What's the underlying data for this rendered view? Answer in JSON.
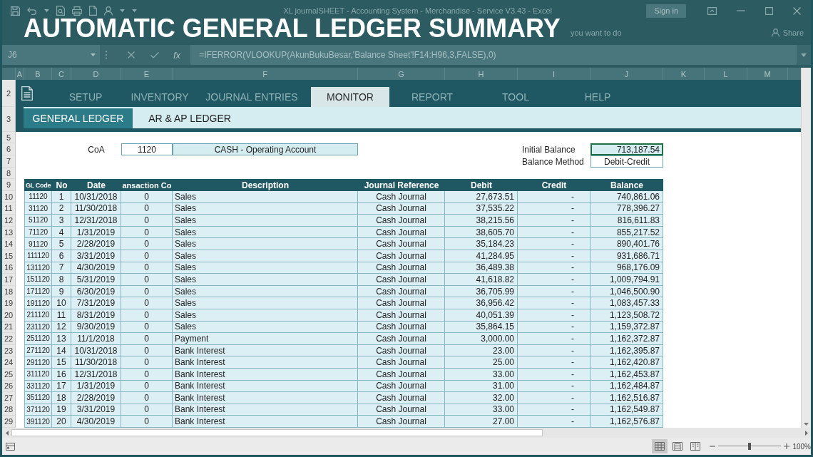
{
  "window": {
    "title": "XL journalSHEET - Accounting System - Merchandise - Service V3.43 - Excel",
    "sign_in": "Sign in"
  },
  "banner_title": "AUTOMATIC GENERAL LEDGER SUMMARY",
  "ribbon": {
    "tell_me": "you want to do",
    "share": "Share"
  },
  "formula_bar": {
    "name_box": "J6",
    "function_label": "fx",
    "formula": "=IFERROR(VLOOKUP(AkunBukuBesar,'Balance Sheet'!F14:H96,3,FALSE),0)"
  },
  "column_headers": [
    "A",
    "B",
    "C",
    "D",
    "E",
    "F",
    "G",
    "H",
    "I",
    "J",
    "K",
    "L",
    "M"
  ],
  "menu": {
    "row_number": "2",
    "tabs": [
      {
        "label": "SETUP",
        "selected": false
      },
      {
        "label": "INVENTORY",
        "selected": false
      },
      {
        "label": "JOURNAL ENTRIES",
        "selected": false
      },
      {
        "label": "MONITOR",
        "selected": true
      },
      {
        "label": "REPORT",
        "selected": false
      },
      {
        "label": "TOOL",
        "selected": false
      },
      {
        "label": "HELP",
        "selected": false
      }
    ]
  },
  "sub_menu": {
    "row_number": "3",
    "tabs": [
      {
        "label": "GENERAL LEDGER",
        "selected": true
      },
      {
        "label": "AR & AP LEDGER",
        "selected": false
      }
    ]
  },
  "form_rows": [
    {
      "kind": "blank",
      "row_number": "5"
    },
    {
      "kind": "account",
      "row_number": "6",
      "coa_label": "CoA",
      "coa_code": "1120",
      "coa_name": "CASH - Operating Account",
      "balance_label": "Initial Balance",
      "balance_value": "713,187.54",
      "balance_active": true
    },
    {
      "kind": "method",
      "row_number": "7",
      "label": "Balance Method",
      "value": "Debit-Credit"
    },
    {
      "kind": "blank",
      "row_number": "8"
    }
  ],
  "ledger": {
    "row_number": "9",
    "columns": [
      "GL Code",
      "No",
      "Date",
      "ansaction Co",
      "Description",
      "Journal Reference",
      "Debit",
      "Credit",
      "Balance"
    ],
    "rows": [
      {
        "row_number": "10",
        "cells": [
          "11120",
          "1",
          "10/31/2018",
          "0",
          "Sales",
          "Cash Journal",
          "27,673.51",
          "-",
          "740,861.06"
        ]
      },
      {
        "row_number": "11",
        "cells": [
          "31120",
          "2",
          "11/30/2018",
          "0",
          "Sales",
          "Cash Journal",
          "37,535.22",
          "-",
          "778,396.27"
        ]
      },
      {
        "row_number": "12",
        "cells": [
          "51120",
          "3",
          "12/31/2018",
          "0",
          "Sales",
          "Cash Journal",
          "38,215.56",
          "-",
          "816,611.83"
        ]
      },
      {
        "row_number": "13",
        "cells": [
          "71120",
          "4",
          "1/31/2019",
          "0",
          "Sales",
          "Cash Journal",
          "38,605.70",
          "-",
          "855,217.52"
        ]
      },
      {
        "row_number": "14",
        "cells": [
          "91120",
          "5",
          "2/28/2019",
          "0",
          "Sales",
          "Cash Journal",
          "35,184.23",
          "-",
          "890,401.76"
        ]
      },
      {
        "row_number": "15",
        "cells": [
          "111120",
          "6",
          "3/31/2019",
          "0",
          "Sales",
          "Cash Journal",
          "41,284.95",
          "-",
          "931,686.71"
        ]
      },
      {
        "row_number": "16",
        "cells": [
          "131120",
          "7",
          "4/30/2019",
          "0",
          "Sales",
          "Cash Journal",
          "36,489.38",
          "-",
          "968,176.09"
        ]
      },
      {
        "row_number": "17",
        "cells": [
          "151120",
          "8",
          "5/31/2019",
          "0",
          "Sales",
          "Cash Journal",
          "41,618.82",
          "-",
          "1,009,794.91"
        ]
      },
      {
        "row_number": "18",
        "cells": [
          "171120",
          "9",
          "6/30/2019",
          "0",
          "Sales",
          "Cash Journal",
          "36,705.99",
          "-",
          "1,046,500.90"
        ]
      },
      {
        "row_number": "19",
        "cells": [
          "191120",
          "10",
          "7/31/2019",
          "0",
          "Sales",
          "Cash Journal",
          "36,956.42",
          "-",
          "1,083,457.33"
        ]
      },
      {
        "row_number": "20",
        "cells": [
          "211120",
          "11",
          "8/31/2019",
          "0",
          "Sales",
          "Cash Journal",
          "40,051.39",
          "-",
          "1,123,508.72"
        ]
      },
      {
        "row_number": "21",
        "cells": [
          "231120",
          "12",
          "9/30/2019",
          "0",
          "Sales",
          "Cash Journal",
          "35,864.15",
          "-",
          "1,159,372.87"
        ]
      },
      {
        "row_number": "22",
        "cells": [
          "251120",
          "13",
          "11/1/2018",
          "0",
          "Payment",
          "Cash Journal",
          "3,000.00",
          "-",
          "1,162,372.87"
        ]
      },
      {
        "row_number": "23",
        "cells": [
          "271120",
          "14",
          "10/31/2018",
          "0",
          "Bank Interest",
          "Cash Journal",
          "23.00",
          "-",
          "1,162,395.87"
        ]
      },
      {
        "row_number": "24",
        "cells": [
          "291120",
          "15",
          "11/30/2018",
          "0",
          "Bank Interest",
          "Cash Journal",
          "25.00",
          "-",
          "1,162,420.87"
        ]
      },
      {
        "row_number": "25",
        "cells": [
          "311120",
          "16",
          "12/31/2018",
          "0",
          "Bank Interest",
          "Cash Journal",
          "33.00",
          "-",
          "1,162,453.87"
        ]
      },
      {
        "row_number": "26",
        "cells": [
          "331120",
          "17",
          "1/31/2019",
          "0",
          "Bank Interest",
          "Cash Journal",
          "31.00",
          "-",
          "1,162,484.87"
        ]
      },
      {
        "row_number": "27",
        "cells": [
          "351120",
          "18",
          "2/28/2019",
          "0",
          "Bank Interest",
          "Cash Journal",
          "32.00",
          "-",
          "1,162,516.87"
        ]
      },
      {
        "row_number": "28",
        "cells": [
          "371120",
          "19",
          "3/31/2019",
          "0",
          "Bank Interest",
          "Cash Journal",
          "33.00",
          "-",
          "1,162,549.87"
        ]
      },
      {
        "row_number": "29",
        "cells": [
          "391120",
          "20",
          "4/30/2019",
          "0",
          "Bank Interest",
          "Cash Journal",
          "27.00",
          "-",
          "1,162,576.87"
        ]
      }
    ]
  },
  "status_bar": {
    "views": [
      {
        "kind": "normal",
        "selected": true
      },
      {
        "kind": "page_layout",
        "selected": false
      },
      {
        "kind": "page_break",
        "selected": false
      }
    ],
    "zoom_slider": {
      "level": 0.5
    },
    "zoom": "100%"
  }
}
